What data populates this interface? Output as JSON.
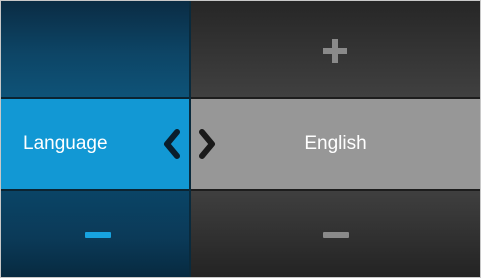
{
  "setting": {
    "label": "Language",
    "value": "English"
  },
  "icons": {
    "increase": "plus-icon",
    "decrease": "minus-icon",
    "previous": "chevron-left-icon",
    "next": "chevron-right-icon"
  },
  "colors": {
    "accent": "#1298d4",
    "left_dark": "#0d4566",
    "value_bg": "#979797",
    "right_dark": "#333333",
    "minus_left": "#17a3e0",
    "plus_right": "#8a8a8a"
  }
}
